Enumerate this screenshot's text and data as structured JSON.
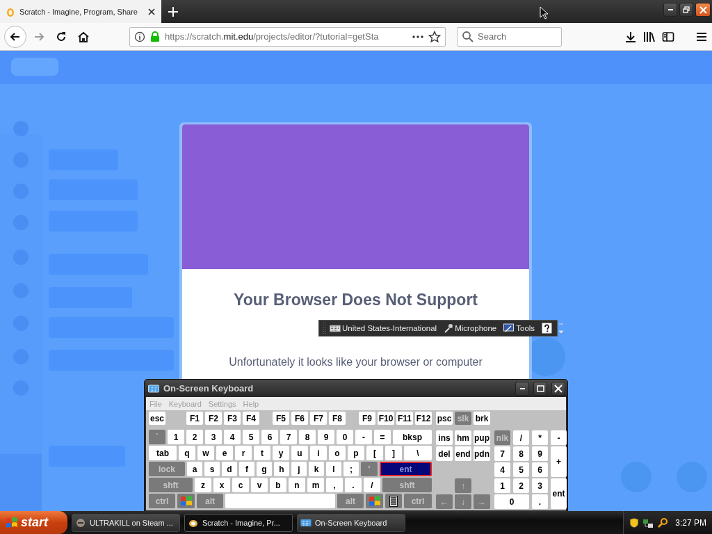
{
  "browser": {
    "tab": {
      "title": "Scratch - Imagine, Program, Share"
    },
    "forward": {
      "disabled": true
    },
    "url": {
      "prefix": "https://scratch.",
      "domain": "mit.edu",
      "path": "/projects/editor/?tutorial=getSta"
    },
    "search": {
      "placeholder": "Search"
    }
  },
  "dialog": {
    "title": "Your Browser Does Not Support",
    "lines": [
      "Unfortunately it looks like your browser or computer"
    ]
  },
  "language_bar": {
    "items": [
      "United States-International",
      "Microphone",
      "Tools"
    ]
  },
  "keyboard": {
    "title": "On-Screen Keyboard",
    "menu": [
      "File",
      "Keyboard",
      "Settings",
      "Help"
    ],
    "main_rows": [
      [
        {
          "label": "esc",
          "kind": "light"
        },
        {
          "label": "F1",
          "kind": "light"
        },
        {
          "label": "F2",
          "kind": "light"
        },
        {
          "label": "F3",
          "kind": "light"
        },
        {
          "label": "F4",
          "kind": "light"
        },
        {
          "label": "F5",
          "kind": "light"
        },
        {
          "label": "F6",
          "kind": "light"
        },
        {
          "label": "F7",
          "kind": "light"
        },
        {
          "label": "F8",
          "kind": "light"
        },
        {
          "label": "F9",
          "kind": "light"
        },
        {
          "label": "F10",
          "kind": "light"
        },
        {
          "label": "F11",
          "kind": "light"
        },
        {
          "label": "F12",
          "kind": "light"
        }
      ],
      [
        {
          "label": "`",
          "kind": "dark"
        },
        {
          "label": "1",
          "kind": "light"
        },
        {
          "label": "2",
          "kind": "light"
        },
        {
          "label": "3",
          "kind": "light"
        },
        {
          "label": "4",
          "kind": "light"
        },
        {
          "label": "5",
          "kind": "light"
        },
        {
          "label": "6",
          "kind": "light"
        },
        {
          "label": "7",
          "kind": "light"
        },
        {
          "label": "8",
          "kind": "light"
        },
        {
          "label": "9",
          "kind": "light"
        },
        {
          "label": "0",
          "kind": "light"
        },
        {
          "label": "-",
          "kind": "light"
        },
        {
          "label": "=",
          "kind": "light"
        },
        {
          "label": "bksp",
          "kind": "light"
        }
      ],
      [
        {
          "label": "tab",
          "kind": "light"
        },
        {
          "label": "q",
          "kind": "light"
        },
        {
          "label": "w",
          "kind": "light"
        },
        {
          "label": "e",
          "kind": "light"
        },
        {
          "label": "r",
          "kind": "light"
        },
        {
          "label": "t",
          "kind": "light"
        },
        {
          "label": "y",
          "kind": "light"
        },
        {
          "label": "u",
          "kind": "light"
        },
        {
          "label": "i",
          "kind": "light"
        },
        {
          "label": "o",
          "kind": "light"
        },
        {
          "label": "p",
          "kind": "light"
        },
        {
          "label": "[",
          "kind": "light"
        },
        {
          "label": "]",
          "kind": "light"
        },
        {
          "label": "\\",
          "kind": "light"
        }
      ],
      [
        {
          "label": "lock",
          "kind": "dark"
        },
        {
          "label": "a",
          "kind": "light"
        },
        {
          "label": "s",
          "kind": "light"
        },
        {
          "label": "d",
          "kind": "light"
        },
        {
          "label": "f",
          "kind": "light"
        },
        {
          "label": "g",
          "kind": "light"
        },
        {
          "label": "h",
          "kind": "light"
        },
        {
          "label": "j",
          "kind": "light"
        },
        {
          "label": "k",
          "kind": "light"
        },
        {
          "label": "l",
          "kind": "light"
        },
        {
          "label": ";",
          "kind": "light"
        },
        {
          "label": "'",
          "kind": "dark"
        },
        {
          "label": "ent",
          "kind": "highlight"
        }
      ],
      [
        {
          "label": "shft",
          "kind": "dark"
        },
        {
          "label": "z",
          "kind": "light"
        },
        {
          "label": "x",
          "kind": "light"
        },
        {
          "label": "c",
          "kind": "light"
        },
        {
          "label": "v",
          "kind": "light"
        },
        {
          "label": "b",
          "kind": "light"
        },
        {
          "label": "n",
          "kind": "light"
        },
        {
          "label": "m",
          "kind": "light"
        },
        {
          "label": ",",
          "kind": "light"
        },
        {
          "label": ".",
          "kind": "light"
        },
        {
          "label": "/",
          "kind": "light"
        },
        {
          "label": "shft",
          "kind": "dark"
        }
      ],
      [
        {
          "label": "ctrl",
          "kind": "dark"
        },
        {
          "kind": "windows"
        },
        {
          "label": "alt",
          "kind": "dark"
        },
        {
          "kind": "space"
        },
        {
          "label": "alt",
          "kind": "dark"
        },
        {
          "kind": "windows"
        },
        {
          "kind": "menu"
        },
        {
          "label": "ctrl",
          "kind": "dark"
        }
      ]
    ],
    "nav": [
      {
        "label": "psc",
        "kind": "light"
      },
      {
        "label": "slk",
        "kind": "dark"
      },
      {
        "label": "brk",
        "kind": "light"
      },
      {
        "label": "ins",
        "kind": "light"
      },
      {
        "label": "hm",
        "kind": "light"
      },
      {
        "label": "pup",
        "kind": "light"
      },
      {
        "label": "del",
        "kind": "light"
      },
      {
        "label": "end",
        "kind": "light"
      },
      {
        "label": "pdn",
        "kind": "light"
      },
      {
        "label": "↑",
        "kind": "dark"
      },
      {
        "label": "←",
        "kind": "dark"
      },
      {
        "label": "↓",
        "kind": "dark"
      },
      {
        "label": "→",
        "kind": "dark"
      }
    ],
    "numpad": [
      {
        "label": "nlk",
        "kind": "dark"
      },
      {
        "label": "/",
        "kind": "light"
      },
      {
        "label": "*",
        "kind": "light"
      },
      {
        "label": "-",
        "kind": "light"
      },
      {
        "label": "7",
        "kind": "light"
      },
      {
        "label": "8",
        "kind": "light"
      },
      {
        "label": "9",
        "kind": "light"
      },
      {
        "label": "+",
        "kind": "light"
      },
      {
        "label": "4",
        "kind": "light"
      },
      {
        "label": "5",
        "kind": "light"
      },
      {
        "label": "6",
        "kind": "light"
      },
      {
        "label": "1",
        "kind": "light"
      },
      {
        "label": "2",
        "kind": "light"
      },
      {
        "label": "3",
        "kind": "light"
      },
      {
        "label": "ent",
        "kind": "light"
      },
      {
        "label": "0",
        "kind": "light"
      },
      {
        "label": ".",
        "kind": "light"
      }
    ]
  },
  "taskbar": {
    "start": "start",
    "tasks": [
      {
        "label": "ULTRAKILL on Steam ...",
        "selected": false
      },
      {
        "label": "Scratch - Imagine, Pr...",
        "selected": true
      },
      {
        "label": "On-Screen Keyboard",
        "selected": false
      }
    ],
    "clock": "3:27 PM"
  }
}
